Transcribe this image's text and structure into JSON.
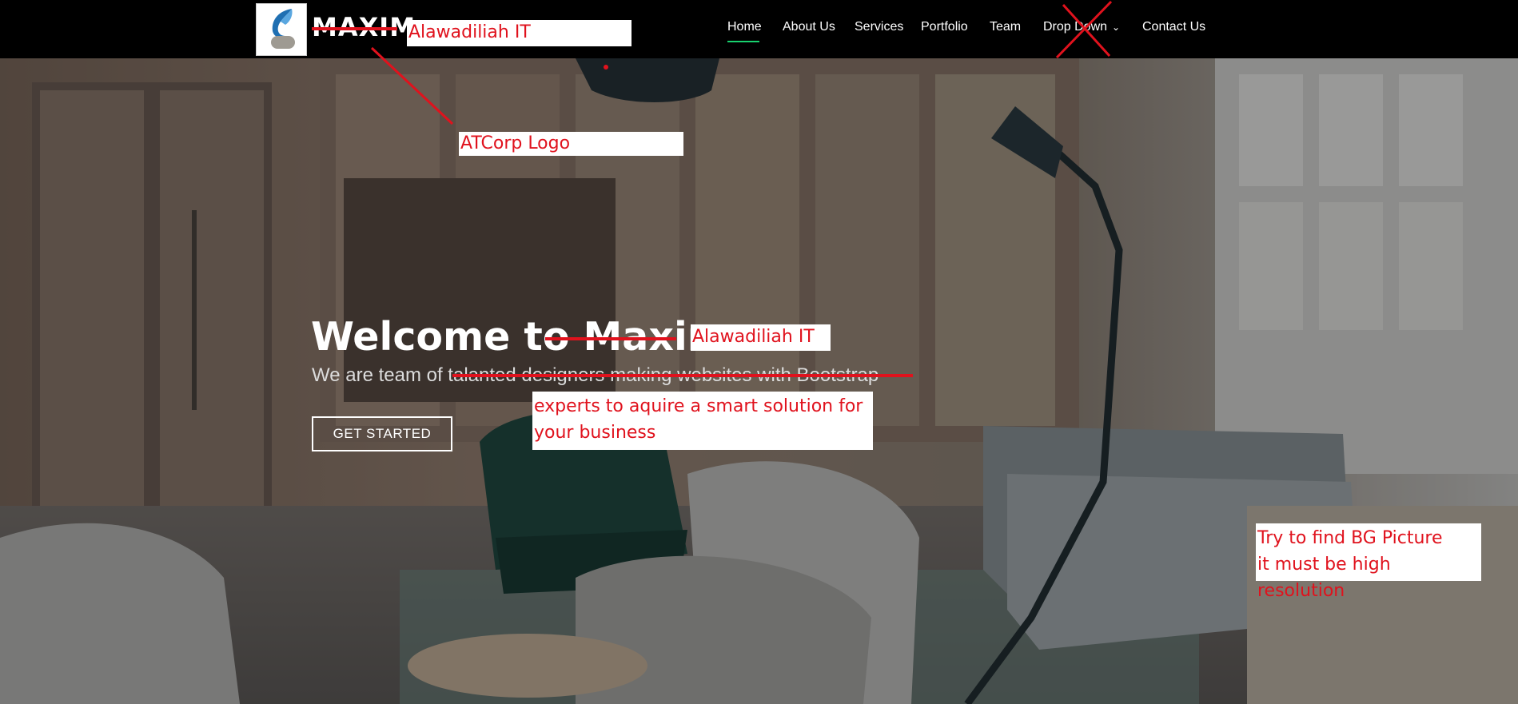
{
  "header": {
    "brand": "MAXIM",
    "nav": [
      {
        "label": "Home",
        "active": true
      },
      {
        "label": "About Us"
      },
      {
        "label": "Services"
      },
      {
        "label": "Portfolio"
      },
      {
        "label": "Team"
      },
      {
        "label": "Drop Down"
      },
      {
        "label": "Contact Us"
      }
    ],
    "dropdown_icon": "chevron-down-icon"
  },
  "hero": {
    "title_prefix": "Welcome to ",
    "title_brand": "Maxim",
    "subtitle_prefix": "We are team of ",
    "subtitle_rest": "talanted designers making websites with Bootstrap",
    "cta": "GET STARTED"
  },
  "annotations": {
    "brand_replacement": "Alawadiliah IT",
    "logo_note": "ATCorp Logo",
    "title_replacement": "Alawadiliah IT",
    "subtitle_replacement_1": "experts to aquire a smart solution for",
    "subtitle_replacement_2": "your business",
    "bg_note_1": "Try to find BG Picture",
    "bg_note_2": "it must be high resolution"
  },
  "colors": {
    "header_bg": "#000000",
    "nav_active_underline": "#18d26e",
    "annotation_red": "#e0121d"
  }
}
